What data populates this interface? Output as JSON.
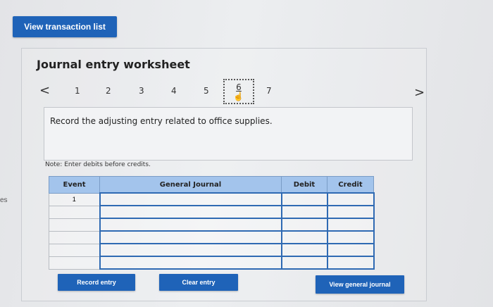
{
  "edge_fragment": "es",
  "view_transactions_label": "View transaction list",
  "worksheet": {
    "title": "Journal entry worksheet",
    "pages": [
      "1",
      "2",
      "3",
      "4",
      "5",
      "6",
      "7"
    ],
    "active_page": "6",
    "prev_arrow": "<",
    "next_arrow": ">",
    "prompt": "Record the adjusting entry related to office supplies.",
    "note": "Note: Enter debits before credits."
  },
  "table": {
    "headers": [
      "Event",
      "General Journal",
      "Debit",
      "Credit"
    ],
    "rows": [
      {
        "event": "1",
        "account": "",
        "debit": "",
        "credit": ""
      },
      {
        "event": "",
        "account": "",
        "debit": "",
        "credit": ""
      },
      {
        "event": "",
        "account": "",
        "debit": "",
        "credit": ""
      },
      {
        "event": "",
        "account": "",
        "debit": "",
        "credit": ""
      },
      {
        "event": "",
        "account": "",
        "debit": "",
        "credit": ""
      },
      {
        "event": "",
        "account": "",
        "debit": "",
        "credit": ""
      }
    ]
  },
  "buttons": {
    "record": "Record entry",
    "clear": "Clear entry",
    "view_general": "View general journal"
  }
}
